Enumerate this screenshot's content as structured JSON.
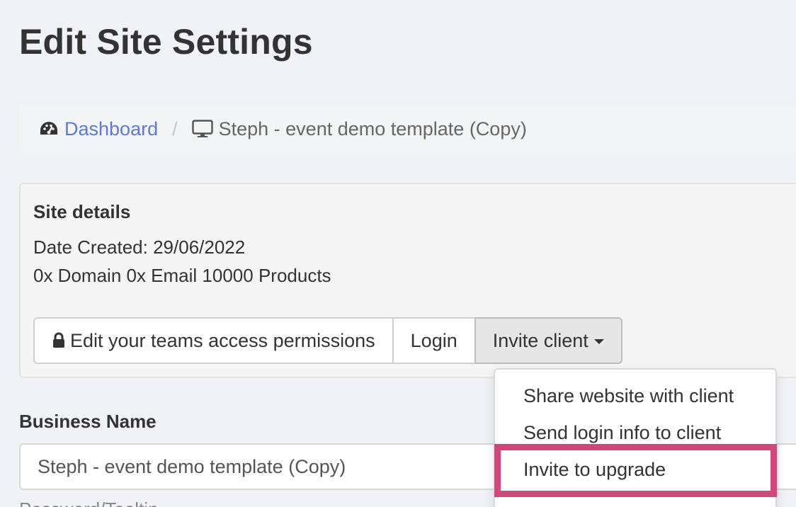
{
  "page": {
    "title": "Edit Site Settings"
  },
  "breadcrumb": {
    "home_label": "Dashboard",
    "separator": "/",
    "current_label": "Steph - event demo template (Copy)",
    "home_icon": "dashboard-gauge-icon",
    "current_icon": "desktop-monitor-icon"
  },
  "site_details": {
    "heading": "Site details",
    "date_created": "Date Created: 29/06/2022",
    "summary": "0x Domain 0x Email 10000 Products"
  },
  "actions": {
    "permissions_label": "Edit your teams access permissions",
    "permissions_icon": "lock-icon",
    "login_label": "Login",
    "invite_label": "Invite client"
  },
  "invite_menu": {
    "items": [
      "Share website with client",
      "Send login info to client",
      "Invite to upgrade"
    ],
    "highlight_color": "#d1477a"
  },
  "business_name": {
    "label": "Business Name",
    "value": "Steph - event demo template (Copy)"
  },
  "next_field": {
    "label_partial": "Password/Tooltip"
  },
  "colors": {
    "link": "#5a7cd6",
    "background": "#f0f2f7"
  }
}
